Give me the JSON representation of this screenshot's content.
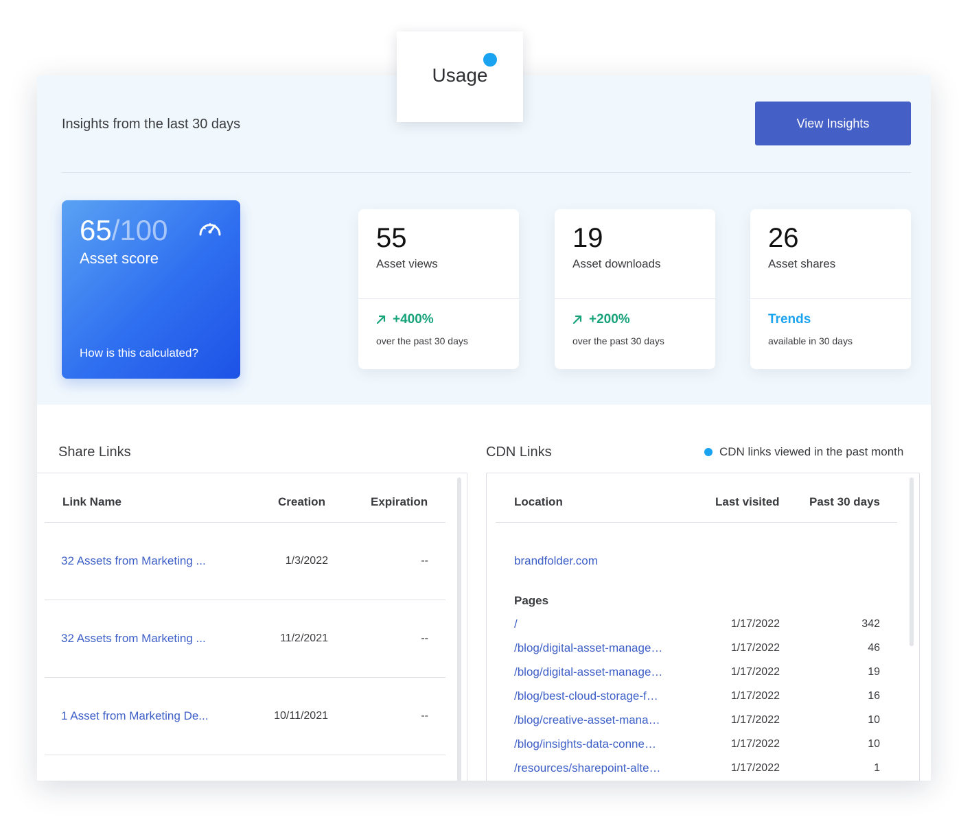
{
  "header": {
    "tab_label": "Usage",
    "insights_title": "Insights from the last 30 days",
    "view_insights_label": "View Insights"
  },
  "asset_score": {
    "score": "65",
    "max": "/100",
    "label": "Asset score",
    "link": "How is this calculated?",
    "icon": "gauge-icon"
  },
  "stats": [
    {
      "value": "55",
      "label": "Asset views",
      "trend": "+400%",
      "trend_sub": "over the past 30 days",
      "trend_color": "#17a37a"
    },
    {
      "value": "19",
      "label": "Asset downloads",
      "trend": "+200%",
      "trend_sub": "over the past 30 days",
      "trend_color": "#17a37a"
    },
    {
      "value": "26",
      "label": "Asset shares",
      "trend": "Trends",
      "trend_sub": "available in 30 days",
      "trend_color": "#1aa3f0"
    }
  ],
  "share_links": {
    "title": "Share Links",
    "columns": [
      "Link Name",
      "Creation",
      "Expiration"
    ],
    "rows": [
      {
        "name": "32 Assets from Marketing ...",
        "creation": "1/3/2022",
        "expiration": "--"
      },
      {
        "name": "32 Assets from Marketing ...",
        "creation": "11/2/2021",
        "expiration": "--"
      },
      {
        "name": "1 Asset from Marketing De...",
        "creation": "10/11/2021",
        "expiration": "--"
      }
    ]
  },
  "cdn_links": {
    "title": "CDN Links",
    "legend": "CDN links viewed in the past month",
    "columns": [
      "Location",
      "Last visited",
      "Past 30 days"
    ],
    "domain": "brandfolder.com",
    "pages_label": "Pages",
    "rows": [
      {
        "path": "/",
        "last_visited": "1/17/2022",
        "count": "342"
      },
      {
        "path": "/blog/digital-asset-manage…",
        "last_visited": "1/17/2022",
        "count": "46"
      },
      {
        "path": "/blog/digital-asset-manage…",
        "last_visited": "1/17/2022",
        "count": "19"
      },
      {
        "path": "/blog/best-cloud-storage-f…",
        "last_visited": "1/17/2022",
        "count": "16"
      },
      {
        "path": "/blog/creative-asset-mana…",
        "last_visited": "1/17/2022",
        "count": "10"
      },
      {
        "path": "/blog/insights-data-conne…",
        "last_visited": "1/17/2022",
        "count": "10"
      },
      {
        "path": "/resources/sharepoint-alte…",
        "last_visited": "1/17/2022",
        "count": "1"
      }
    ]
  },
  "colors": {
    "accent": "#4460c7",
    "link": "#3d5fc7",
    "positive": "#17a37a",
    "info": "#1aa3f0"
  }
}
